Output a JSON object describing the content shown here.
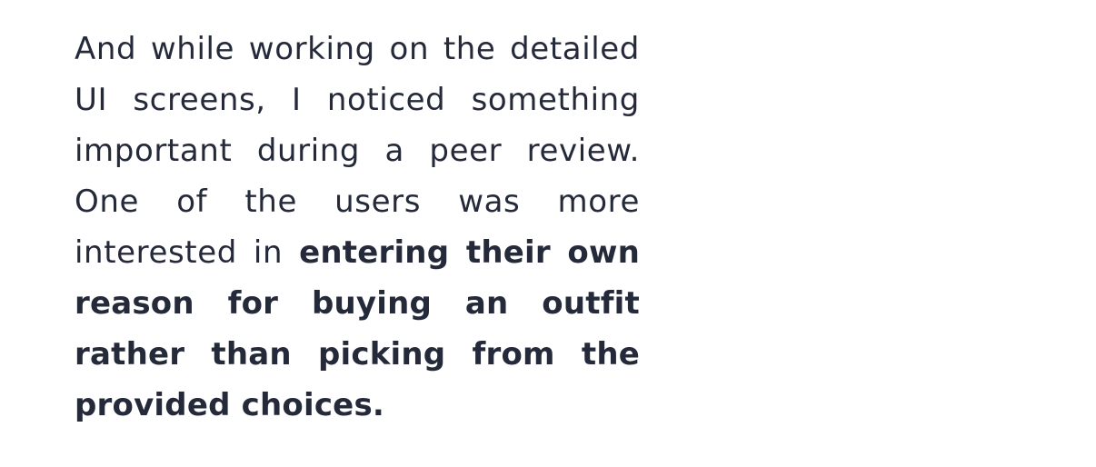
{
  "article": {
    "paragraph_regular": "And while working on the detailed UI screens, I noticed something important during a peer review. One of the users was more interested in ",
    "paragraph_bold": "entering their own reason for buying an outfit rather than picking from the provided choices."
  },
  "colors": {
    "text": "#252a3a",
    "background": "#ffffff"
  }
}
